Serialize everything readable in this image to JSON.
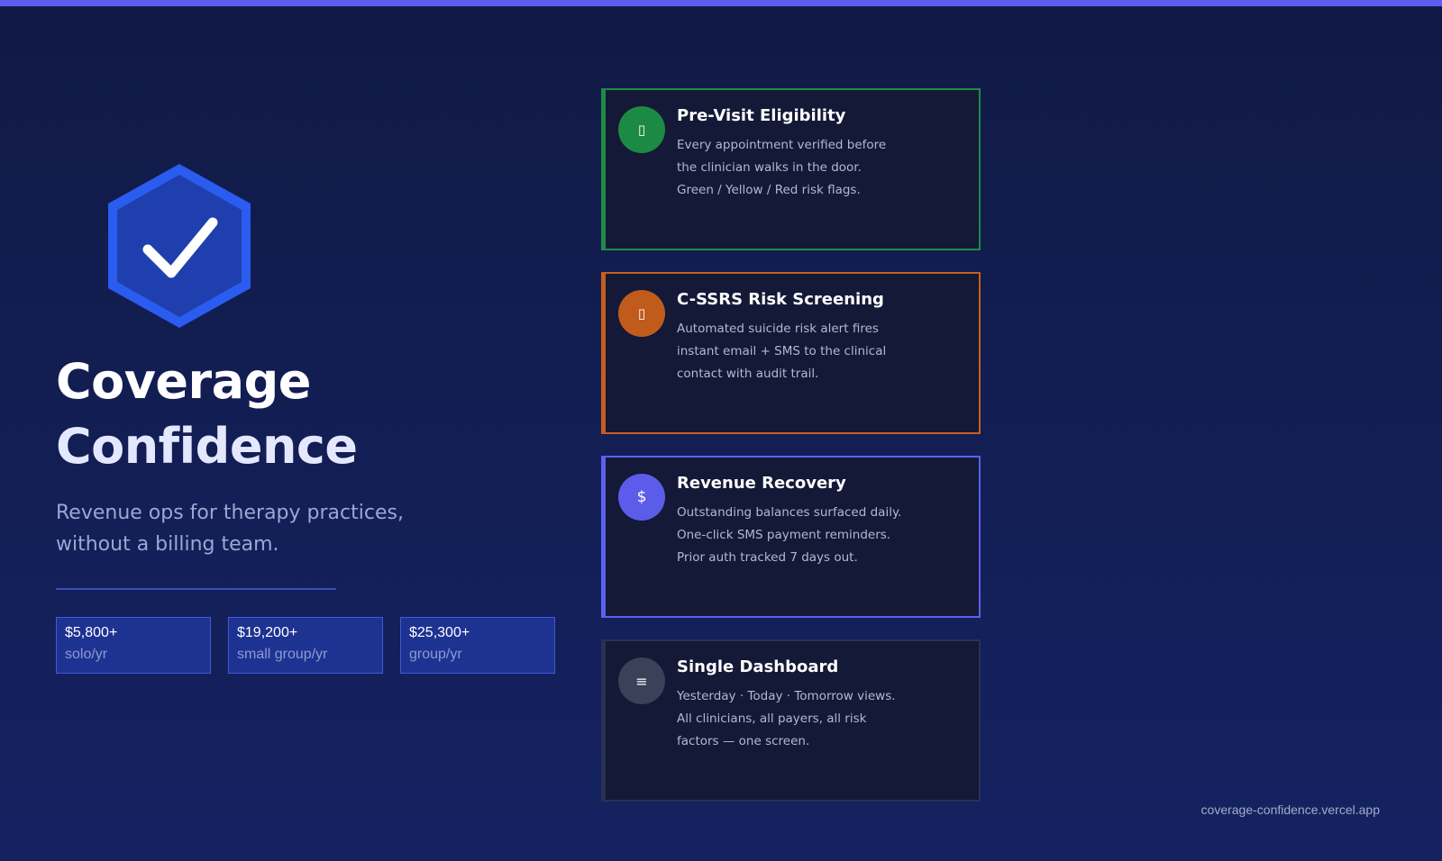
{
  "colors": {
    "top_bar": "#5b5ef0",
    "background": "#131d52",
    "accent_green": "#1f8a45",
    "accent_orange": "#c75e1e",
    "accent_violet": "#5c60ee",
    "accent_gray": "#3a4159"
  },
  "hero": {
    "logo_icon": "shield-check-icon",
    "title_line1": "Coverage",
    "title_line2": "Confidence",
    "subtitle_line1": "Revenue ops for therapy practices,",
    "subtitle_line2": "without a billing team."
  },
  "stats": [
    {
      "value": "$5,800+",
      "label": "solo/yr"
    },
    {
      "value": "$19,200+",
      "label": "small group/yr"
    },
    {
      "value": "$25,300+",
      "label": "group/yr"
    }
  ],
  "features": [
    {
      "icon": "clipboard-icon",
      "icon_glyph": "▯",
      "title": "Pre-Visit Eligibility",
      "lines": [
        "Every appointment verified before",
        "the clinician walks in the door.",
        "Green / Yellow / Red risk flags."
      ]
    },
    {
      "icon": "alert-icon",
      "icon_glyph": "▯",
      "title": "C-SSRS Risk Screening",
      "lines": [
        "Automated suicide risk alert fires",
        "instant email + SMS to the clinical",
        "contact with audit trail."
      ]
    },
    {
      "icon": "dollar-icon",
      "icon_glyph": "$",
      "title": "Revenue Recovery",
      "lines": [
        "Outstanding balances surfaced daily.",
        "One-click SMS payment reminders.",
        "Prior auth tracked 7 days out."
      ]
    },
    {
      "icon": "menu-icon",
      "icon_glyph": "≡",
      "title": "Single Dashboard",
      "lines": [
        "Yesterday · Today · Tomorrow views.",
        "All clinicians, all payers, all risk",
        "factors — one screen."
      ]
    }
  ],
  "footer": {
    "url": "coverage-confidence.vercel.app"
  }
}
